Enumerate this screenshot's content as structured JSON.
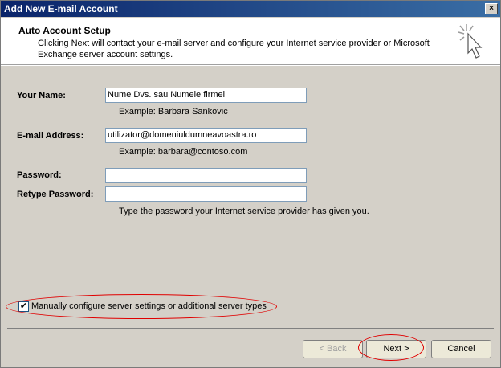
{
  "window": {
    "title": "Add New E-mail Account",
    "close_glyph": "×"
  },
  "header": {
    "title": "Auto Account Setup",
    "description": "Clicking Next will contact your e-mail server and configure your Internet service provider or Microsoft Exchange server account settings.",
    "icon": "wizard-cursor-icon"
  },
  "form": {
    "name_label": "Your Name:",
    "name_value": "Nume Dvs. sau Numele firmei",
    "name_example": "Example: Barbara Sankovic",
    "email_label": "E-mail Address:",
    "email_value": "utilizator@domeniuldumneavoastra.ro",
    "email_example": "Example: barbara@contoso.com",
    "password_label": "Password:",
    "password_value": "",
    "retype_label": "Retype Password:",
    "retype_value": "",
    "password_hint": "Type the password your Internet service provider has given you."
  },
  "manual": {
    "checked": true,
    "check_glyph": "✔",
    "label": "Manually configure server settings or additional server types"
  },
  "buttons": {
    "back": "< Back",
    "next": "Next >",
    "cancel": "Cancel"
  },
  "annotation_color": "#e00000"
}
